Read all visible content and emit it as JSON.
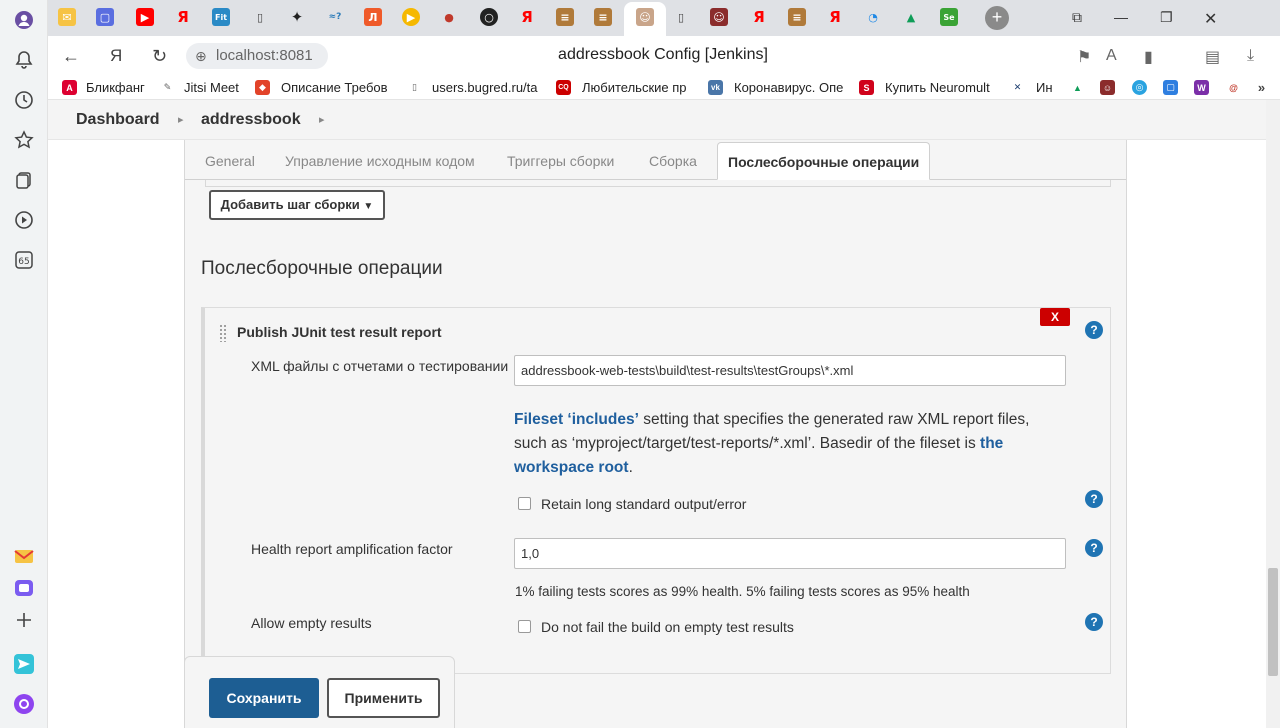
{
  "browser": {
    "url": "localhost:8081",
    "page_title": "addressbook Config [Jenkins]",
    "bookmarks": [
      {
        "label": "Бликфанг",
        "icon": "angular-icon",
        "color": "#dd0031"
      },
      {
        "label": "Jitsi Meet",
        "icon": "feather-icon",
        "color": "#666666"
      },
      {
        "label": "Описание Требов",
        "icon": "gitlab-icon",
        "color": "#e24329"
      },
      {
        "label": "users.bugred.ru/ta",
        "icon": "page-icon",
        "color": "#666666"
      },
      {
        "label": "Любительские пр",
        "icon": "cq-icon",
        "color": "#cc0000"
      },
      {
        "label": "Коронавирус. Опе",
        "icon": "vk-icon",
        "color": "#4a76a8"
      },
      {
        "label": "Купить Neuromult",
        "icon": "s-icon",
        "color": "#d0021b"
      },
      {
        "label": "Ин",
        "icon": "x-tools-icon",
        "color": "#1a3c6e"
      }
    ]
  },
  "breadcrumb": {
    "dashboard": "Dashboard",
    "job": "addressbook"
  },
  "tabs": {
    "general": "General",
    "scm": "Управление исходным кодом",
    "triggers": "Триггеры сборки",
    "build": "Сборка",
    "post_build": "Послесборочные операции"
  },
  "build_section": {
    "add_step_label": "Добавить шаг сборки"
  },
  "post_build": {
    "section_title": "Послесборочные операции",
    "junit": {
      "title": "Publish JUnit test result report",
      "delete_label": "X",
      "xml_label": "XML файлы с отчетами о тестировании",
      "xml_value": "addressbook-web-tests\\build\\test-results\\testGroups\\*.xml",
      "desc_link1": "Fileset ‘includes’",
      "desc_text1": " setting that specifies the generated raw XML report files, such as ‘myproject/target/test-reports/*.xml’. Basedir of the fileset is ",
      "desc_link2": "the workspace root",
      "desc_text2": ".",
      "retain_label": "Retain long standard output/error",
      "health_label": "Health report amplification factor",
      "health_value": "1,0",
      "health_desc": "1% failing tests scores as 99% health. 5% failing tests scores as 95% health",
      "allow_empty_label": "Allow empty results",
      "allow_empty_cb_label": "Do not fail the build on empty test results"
    }
  },
  "actions": {
    "save": "Сохранить",
    "apply": "Применить"
  },
  "help_glyph": "?"
}
